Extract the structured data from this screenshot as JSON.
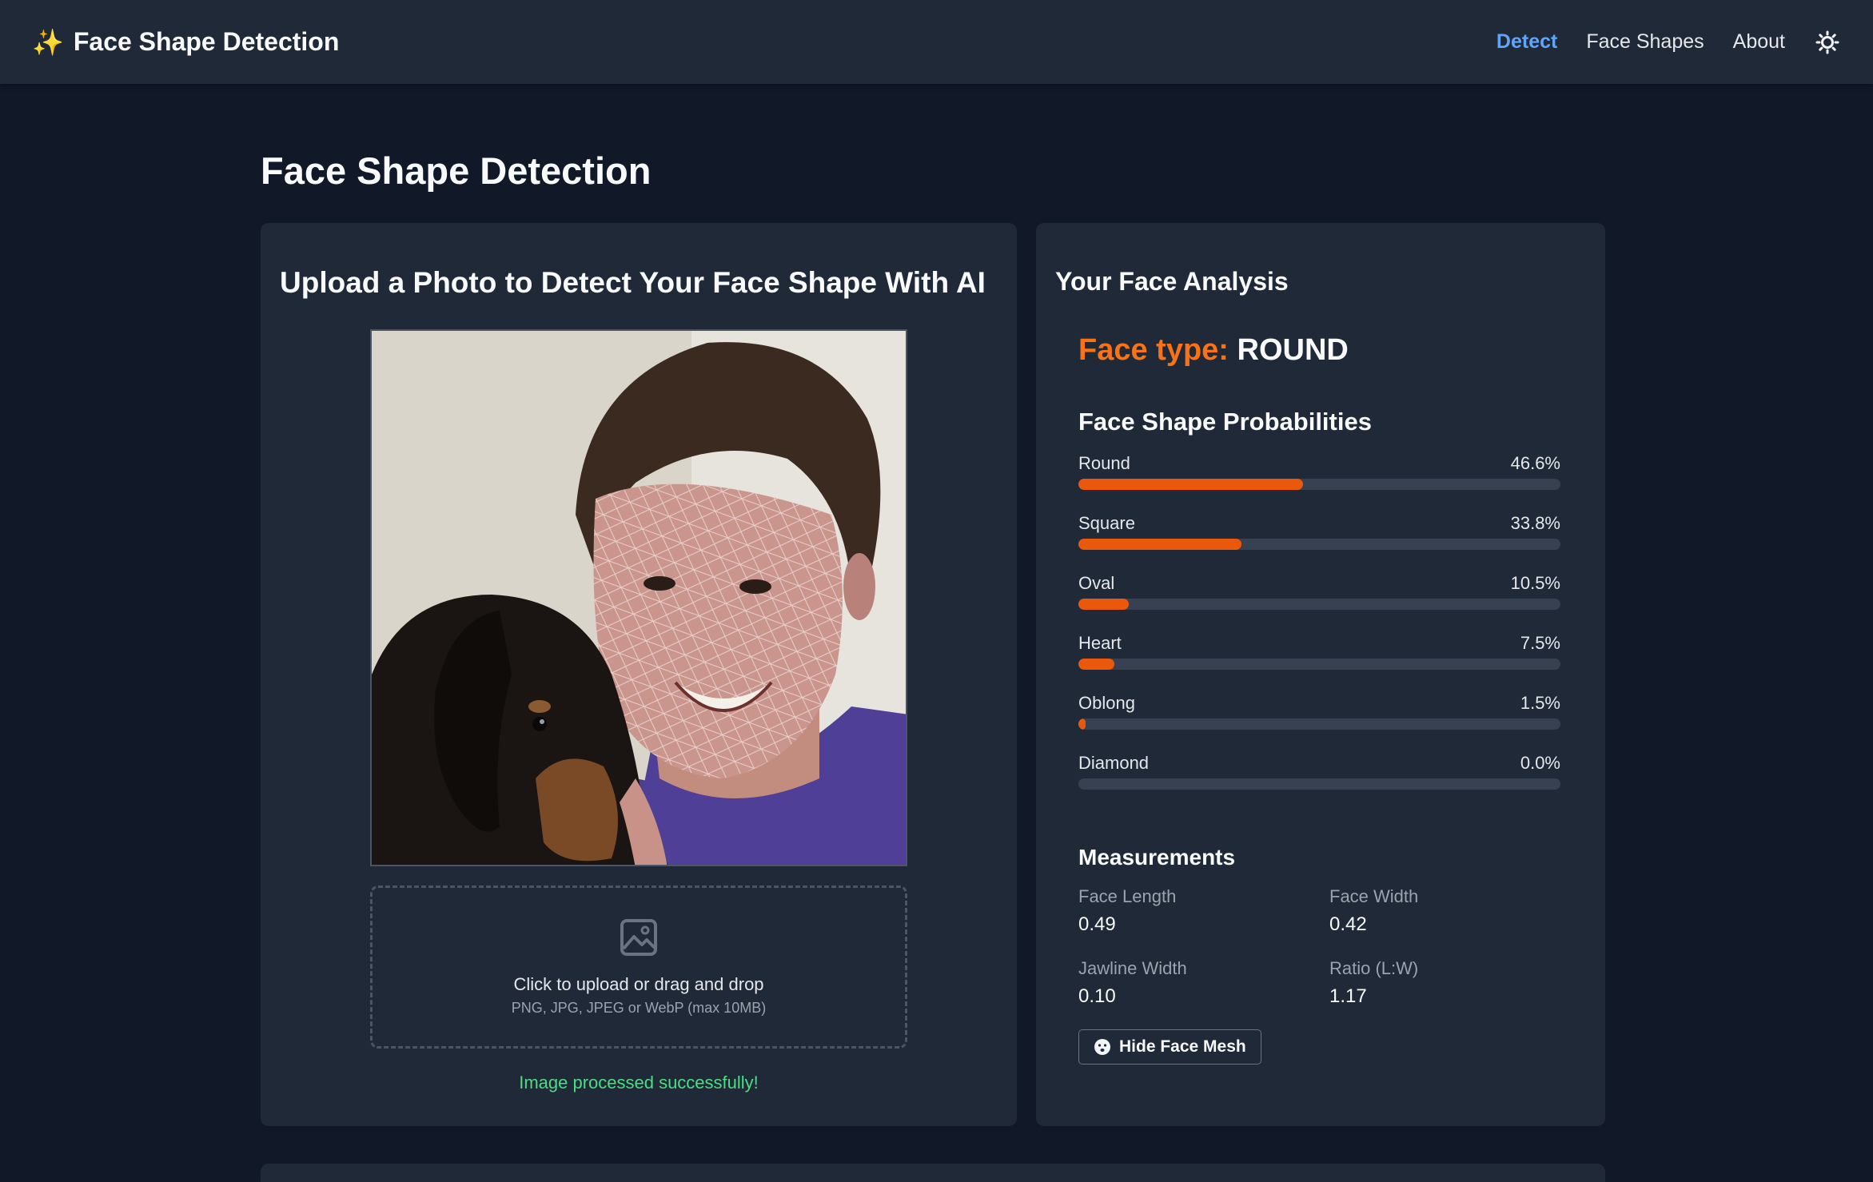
{
  "navbar": {
    "brand_icon": "sparkles-icon",
    "brand_title": "Face Shape Detection",
    "links": [
      {
        "label": "Detect",
        "active": true
      },
      {
        "label": "Face Shapes",
        "active": false
      },
      {
        "label": "About",
        "active": false
      }
    ],
    "theme_icon": "sun-icon"
  },
  "page": {
    "title": "Face Shape Detection"
  },
  "upload": {
    "title": "Upload a Photo to Detect Your Face Shape With AI",
    "dropzone_icon": "image-icon",
    "dropzone_text": "Click to upload or drag and drop",
    "dropzone_hint": "PNG, JPG, JPEG or WebP (max 10MB)",
    "status": "Image processed successfully!"
  },
  "analysis": {
    "title": "Your Face Analysis",
    "face_type_label": "Face type:",
    "face_type_value": "ROUND",
    "probabilities_title": "Face Shape Probabilities",
    "probabilities": [
      {
        "label": "Round",
        "percent_text": "46.6%",
        "value": 46.6
      },
      {
        "label": "Square",
        "percent_text": "33.8%",
        "value": 33.8
      },
      {
        "label": "Oval",
        "percent_text": "10.5%",
        "value": 10.5
      },
      {
        "label": "Heart",
        "percent_text": "7.5%",
        "value": 7.5
      },
      {
        "label": "Oblong",
        "percent_text": "1.5%",
        "value": 1.5
      },
      {
        "label": "Diamond",
        "percent_text": "0.0%",
        "value": 0.0
      }
    ],
    "measurements_title": "Measurements",
    "measurements": [
      {
        "label": "Face Length",
        "value": "0.49"
      },
      {
        "label": "Face Width",
        "value": "0.42"
      },
      {
        "label": "Jawline Width",
        "value": "0.10"
      },
      {
        "label": "Ratio (L:W)",
        "value": "1.17"
      }
    ],
    "mesh_button_label": "Hide Face Mesh",
    "mesh_button_icon": "face-icon"
  },
  "colors": {
    "accent": "#f97316",
    "bar_fill": "#ea580c",
    "link_active": "#60a5fa",
    "success": "#4ade80"
  }
}
